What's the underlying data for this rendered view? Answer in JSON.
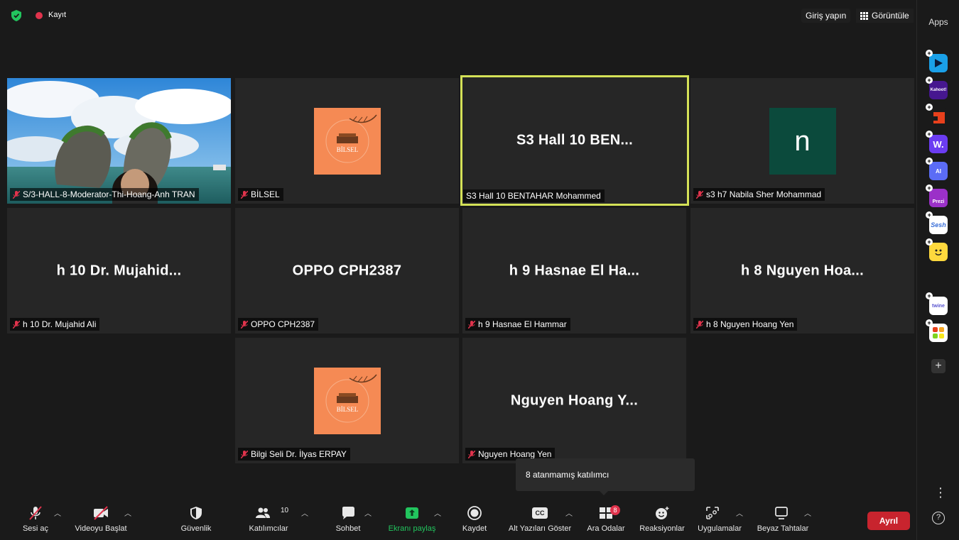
{
  "topbar": {
    "record_label": "Kayıt",
    "signin_label": "Giriş yapın",
    "view_label": "Görüntüle"
  },
  "tiles": [
    {
      "big": "",
      "name": "S/3-HALL-8-Moderator-Thi-Hoang-Anh TRAN"
    },
    {
      "big": "",
      "name": "BİLSEL",
      "logo_text": "BİLSEL"
    },
    {
      "big": "S3  Hall 10  BEN...",
      "name": "S3  Hall 10  BENTAHAR Mohammed"
    },
    {
      "big": "",
      "name": "s3 h7 Nabila Sher Mohammad",
      "avatar": "n"
    },
    {
      "big": "h 10 Dr. Mujahid...",
      "name": "h 10 Dr. Mujahid Ali"
    },
    {
      "big": "OPPO CPH2387",
      "name": "OPPO CPH2387"
    },
    {
      "big": "h 9 Hasnae El Ha...",
      "name": "h 9 Hasnae El Hammar"
    },
    {
      "big": "h 8 Nguyen Hoa...",
      "name": "h 8 Nguyen Hoang Yen"
    },
    {
      "big": "",
      "name": "Bilgi Seli Dr. İlyas ERPAY",
      "logo_text": "BİLSEL"
    },
    {
      "big": "Nguyen Hoang Y...",
      "name": "Nguyen Hoang Yen"
    }
  ],
  "apps": {
    "title": "Apps",
    "items": [
      {
        "name": "app-1",
        "color": "#1aa0e8",
        "label": ""
      },
      {
        "name": "kahoot",
        "color": "#46178f",
        "label": "Kahoot!"
      },
      {
        "name": "app-3",
        "color": "#e8401c",
        "label": ""
      },
      {
        "name": "wooclap",
        "color": "#6b3cf2",
        "label": "W."
      },
      {
        "name": "ai-app",
        "color": "#5b6cf5",
        "label": "AI"
      },
      {
        "name": "prezi",
        "color": "#9b30c8",
        "label": "Prezi"
      },
      {
        "name": "sesh",
        "color": "#ffffff",
        "label": "Sesh"
      },
      {
        "name": "app-8",
        "color": "#ffd93d",
        "label": ""
      },
      {
        "name": "twine",
        "color": "#ffffff",
        "label": "twine"
      },
      {
        "name": "app-10",
        "color": "#ffffff",
        "label": ""
      }
    ]
  },
  "toolbar": {
    "unmute": "Sesi aç",
    "start_video": "Videoyu Başlat",
    "security": "Güvenlik",
    "participants": "Katılımcılar",
    "participants_count": "10",
    "chat": "Sohbet",
    "share": "Ekranı paylaş",
    "record": "Kaydet",
    "captions": "Alt Yazıları Göster",
    "captions_icon": "CC",
    "breakout": "Ara Odalar",
    "breakout_badge": "8",
    "reactions": "Reaksiyonlar",
    "apps": "Uygulamalar",
    "whiteboards": "Beyaz Tahtalar",
    "leave": "Ayrıl"
  },
  "tooltip": "8 atanmamış katılımcı",
  "colors": {
    "active_speaker": "#d4e157",
    "leave": "#c8242e",
    "share": "#22c55e",
    "mute": "#e0334c"
  }
}
